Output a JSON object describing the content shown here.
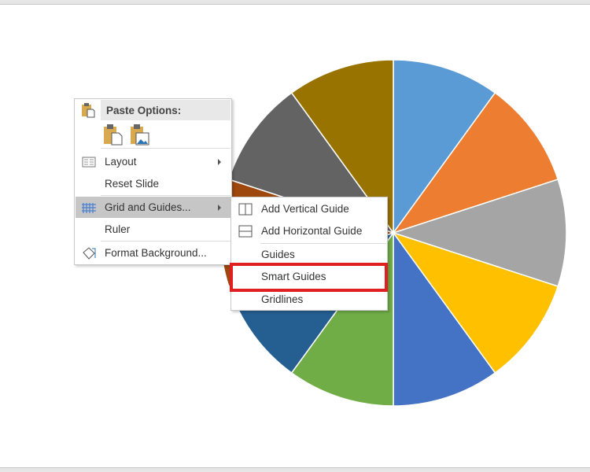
{
  "chart_data": {
    "type": "pie",
    "values": [
      1,
      1,
      1,
      1,
      1,
      1,
      1,
      1,
      1,
      1
    ],
    "colors": [
      "#5B9BD5",
      "#ED7D31",
      "#A5A5A5",
      "#FFC000",
      "#4472C4",
      "#70AD47",
      "#255E91",
      "#9E480E",
      "#636363",
      "#997300"
    ]
  },
  "context_menu": {
    "paste_header": "Paste Options:",
    "paste_icons": [
      "paste-keep-formatting-icon",
      "paste-picture-icon"
    ],
    "items": [
      {
        "label": "Layout",
        "access": "L",
        "submenu": true
      },
      {
        "label": "Reset Slide",
        "access": "R"
      },
      {
        "label": "Grid and Guides...",
        "access": "i",
        "submenu": true,
        "highlighted": true
      },
      {
        "label": "Ruler",
        "access": "R"
      },
      {
        "label": "Format Background...",
        "access": "B"
      }
    ]
  },
  "submenu": {
    "items": [
      {
        "label": "Add Vertical Guide",
        "access": "V"
      },
      {
        "label": "Add Horizontal Guide",
        "access": "H"
      },
      {
        "label": "Guides",
        "access": "G"
      },
      {
        "label": "Smart Guides",
        "access": "S",
        "highlighted_box": true
      },
      {
        "label": "Gridlines",
        "access": "l"
      }
    ]
  },
  "highlight_color": "#E02020"
}
